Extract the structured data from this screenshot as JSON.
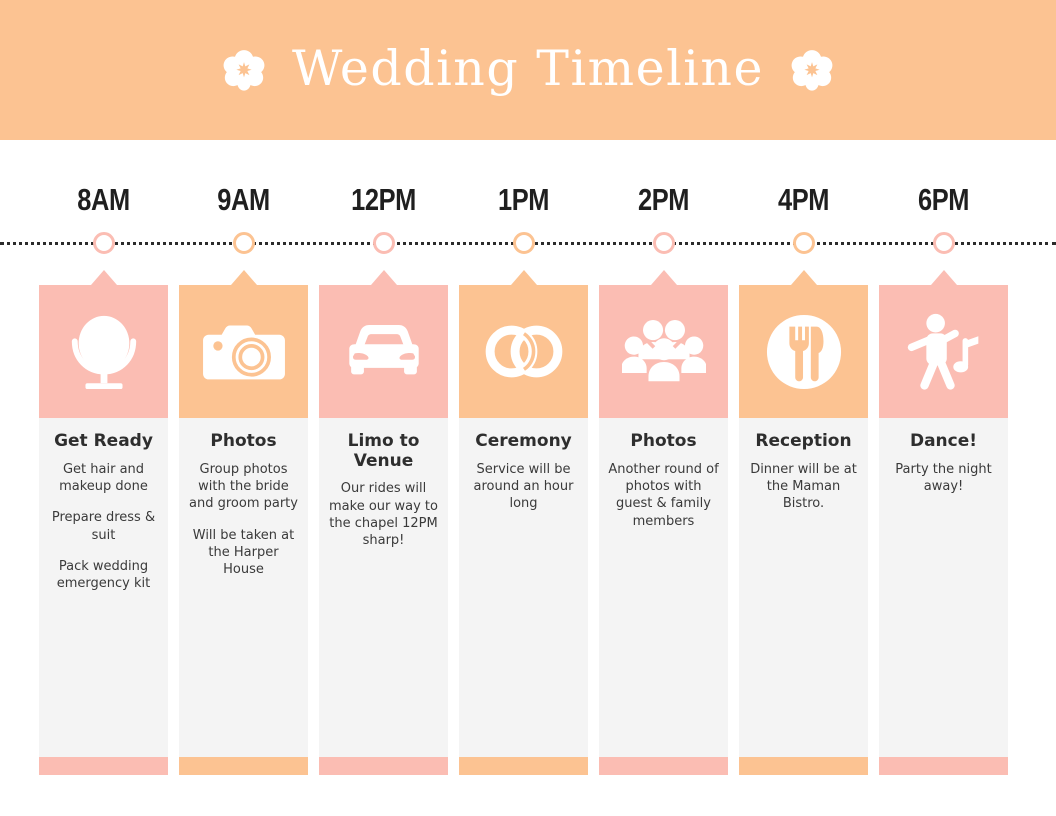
{
  "header": {
    "title": "Wedding Timeline",
    "left_flower_icon": "flower-icon",
    "right_flower_icon": "flower-icon",
    "background_color": "#fcc392",
    "title_color": "#ffffff"
  },
  "theme": {
    "pink": "#fbbdb3",
    "orange": "#fcc392",
    "card_body": "#f4f4f4",
    "text_dark": "#2e2e2e",
    "line_color": "#2b2b2b"
  },
  "timeline": {
    "line_style": "dotted",
    "events": [
      {
        "time": "8AM",
        "title": "Get Ready",
        "icon": "vanity-mirror-icon",
        "accent": "#fbbdb3",
        "paragraphs": [
          "Get hair and makeup done",
          "Prepare dress & suit",
          "Pack wedding emergency kit"
        ]
      },
      {
        "time": "9AM",
        "title": "Photos",
        "icon": "camera-icon",
        "accent": "#fcc392",
        "paragraphs": [
          "Group photos with the bride and groom party",
          "Will be taken at the Harper House"
        ]
      },
      {
        "time": "12PM",
        "title": "Limo to Venue",
        "icon": "car-icon",
        "accent": "#fbbdb3",
        "paragraphs": [
          "Our rides will make our way to the chapel 12PM sharp!"
        ]
      },
      {
        "time": "1PM",
        "title": "Ceremony",
        "icon": "wedding-rings-icon",
        "accent": "#fcc392",
        "paragraphs": [
          "Service will be around an hour long"
        ]
      },
      {
        "time": "2PM",
        "title": "Photos",
        "icon": "group-people-icon",
        "accent": "#fbbdb3",
        "paragraphs": [
          "Another round of photos with guest & family members"
        ]
      },
      {
        "time": "4PM",
        "title": "Reception",
        "icon": "plate-fork-knife-icon",
        "accent": "#fcc392",
        "paragraphs": [
          "Dinner will be at the Maman Bistro."
        ]
      },
      {
        "time": "6PM",
        "title": "Dance!",
        "icon": "dancing-person-icon",
        "accent": "#fbbdb3",
        "paragraphs": [
          "Party the night away!"
        ]
      }
    ]
  }
}
